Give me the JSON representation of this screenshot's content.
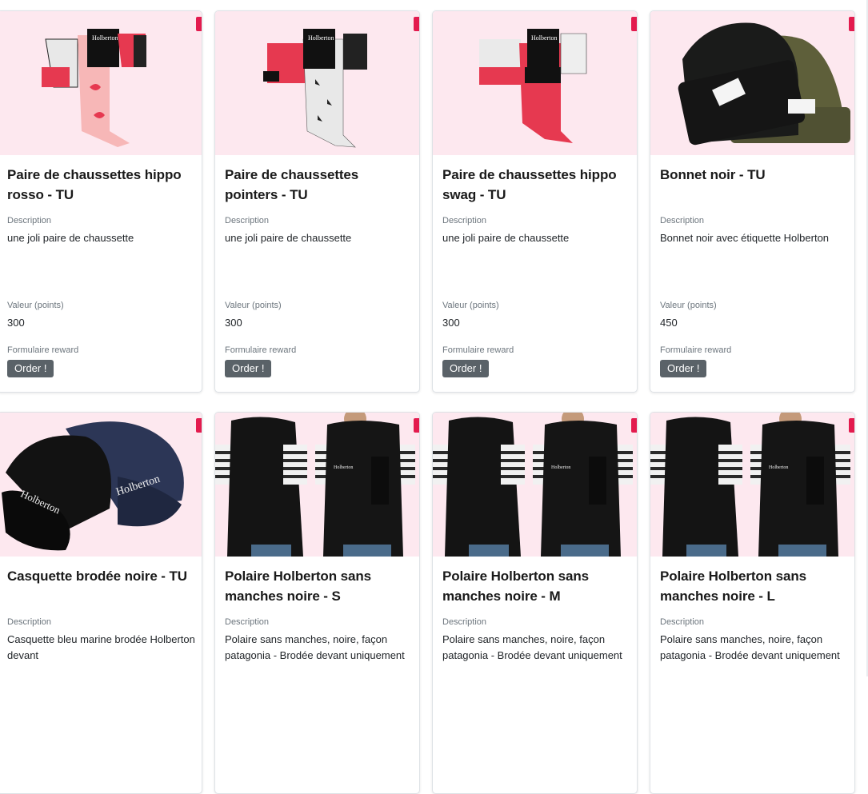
{
  "products": [
    {
      "title": "Paire de chaussettes hippo rosso - TU",
      "desc_label": "Description",
      "desc": "une joli paire de chaussette",
      "value_label": "Valeur (points)",
      "value": "300",
      "form_label": "Formulaire reward",
      "button": "Order !",
      "image_icon": "socks-image"
    },
    {
      "title": "Paire de chaussettes pointers - TU",
      "desc_label": "Description",
      "desc": "une joli paire de chaussette",
      "value_label": "Valeur (points)",
      "value": "300",
      "form_label": "Formulaire reward",
      "button": "Order !",
      "image_icon": "socks-image"
    },
    {
      "title": "Paire de chaussettes hippo swag - TU",
      "desc_label": "Description",
      "desc": "une joli paire de chaussette",
      "value_label": "Valeur (points)",
      "value": "300",
      "form_label": "Formulaire reward",
      "button": "Order !",
      "image_icon": "socks-image"
    },
    {
      "title": "Bonnet noir - TU",
      "desc_label": "Description",
      "desc": "Bonnet noir avec étiquette Holberton",
      "value_label": "Valeur (points)",
      "value": "450",
      "form_label": "Formulaire reward",
      "button": "Order !",
      "image_icon": "beanie-image"
    },
    {
      "title": "Casquette brodée noire - TU",
      "desc_label": "Description",
      "desc": "Casquette bleu marine brodée Holberton devant",
      "image_icon": "cap-image"
    },
    {
      "title": "Polaire Holberton sans manches noire - S",
      "desc_label": "Description",
      "desc": "Polaire sans manches, noire, façon patagonia - Brodée devant uniquement",
      "image_icon": "fleece-vest-image"
    },
    {
      "title": "Polaire Holberton sans manches noire - M",
      "desc_label": "Description",
      "desc": "Polaire sans manches, noire, façon patagonia - Brodée devant uniquement",
      "image_icon": "fleece-vest-image"
    },
    {
      "title": "Polaire Holberton sans manches noire - L",
      "desc_label": "Description",
      "desc": "Polaire sans manches, noire, façon patagonia - Brodée devant uniquement",
      "image_icon": "fleece-vest-image"
    }
  ],
  "image_labels": {
    "brand": "Holberton"
  },
  "colors": {
    "image_bg": "#fde8ef",
    "button_bg": "#5a6268",
    "accent": "#e31b4e"
  }
}
